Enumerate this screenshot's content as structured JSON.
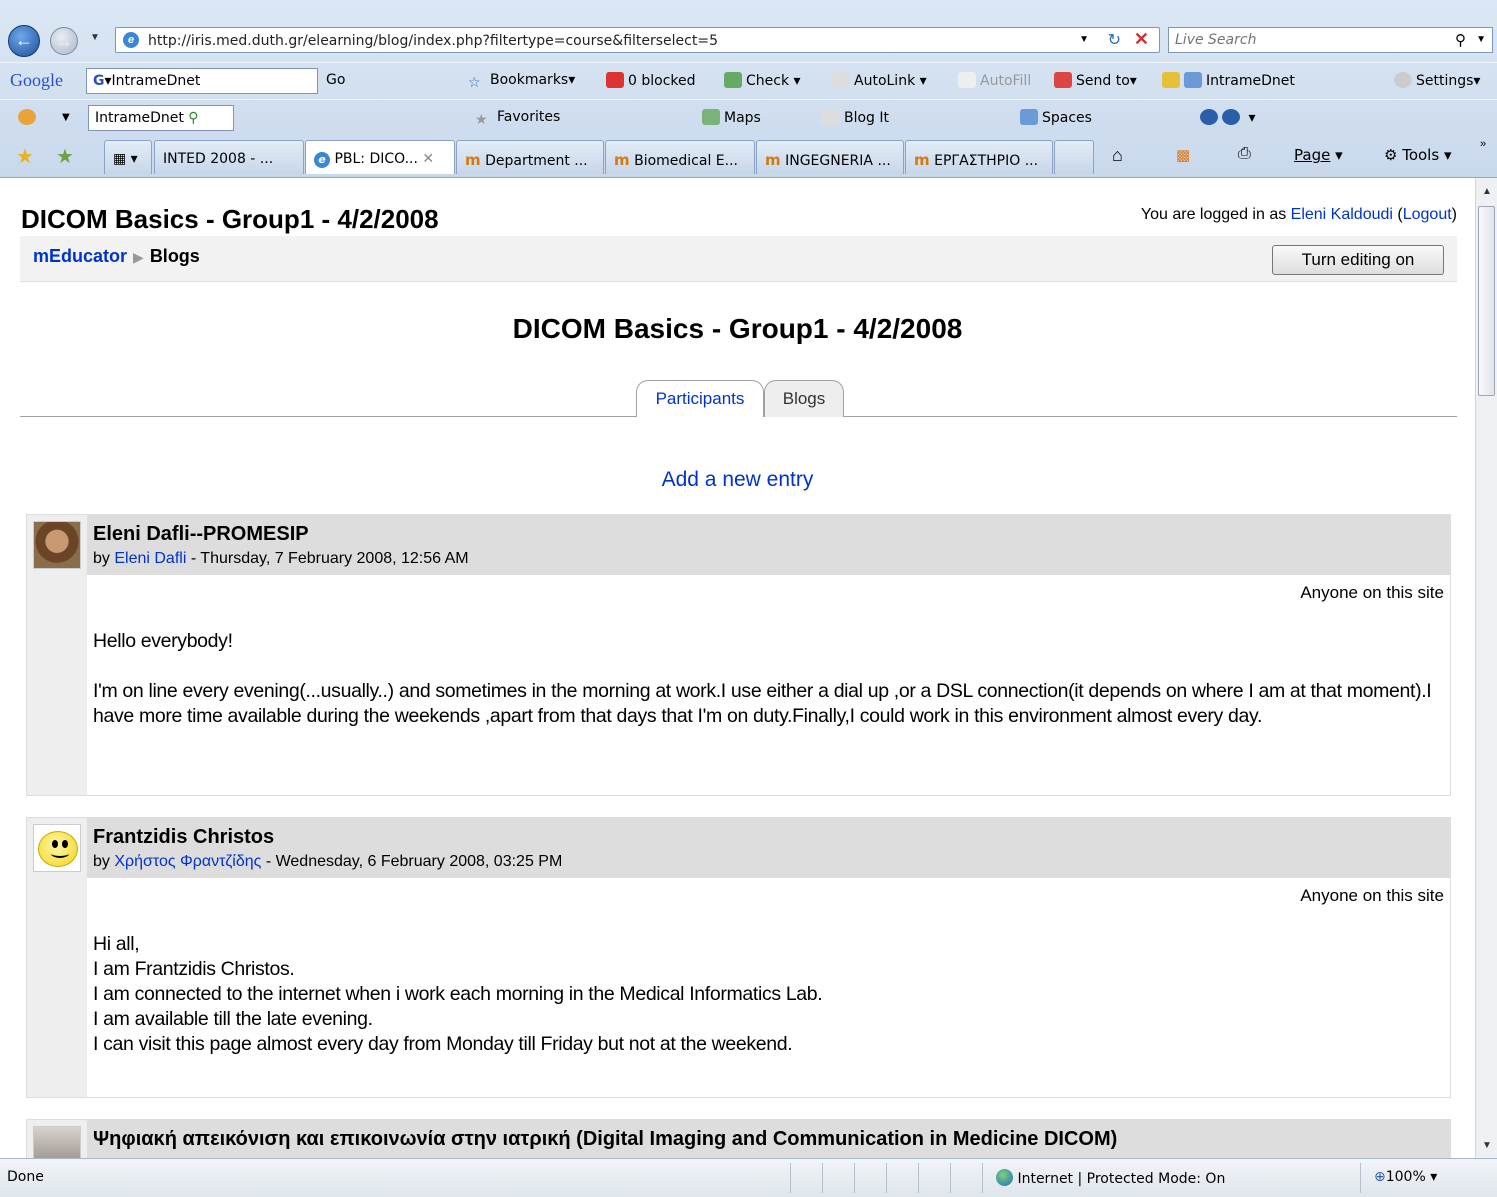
{
  "browser": {
    "url": "http://iris.med.duth.gr/elearning/blog/index.php?filtertype=course&filterselect=5",
    "search_placeholder": "Live Search",
    "google_toolbar": {
      "logo": "Google",
      "search_value": "IntrameDnet",
      "go": "Go",
      "bookmarks": "Bookmarks",
      "blocked": "0 blocked",
      "check": "Check",
      "autolink": "AutoLink",
      "autofill": "AutoFill",
      "send_to": "Send to",
      "intramednet": "IntrameDnet",
      "settings": "Settings"
    },
    "links_toolbar": {
      "search_value": "IntrameDnet",
      "favorites": "Favorites",
      "maps": "Maps",
      "blog_it": "Blog It",
      "spaces": "Spaces"
    },
    "tabs": [
      {
        "label": "INTED 2008 - ..."
      },
      {
        "label": "PBL: DICO..."
      },
      {
        "label": "Department ..."
      },
      {
        "label": "Biomedical E..."
      },
      {
        "label": "INGEGNERIA ..."
      },
      {
        "label": "ΕΡΓΑΣΤΗΡΙΟ ..."
      }
    ],
    "command_bar": {
      "page": "Page",
      "tools": "Tools"
    },
    "status": {
      "text": "Done",
      "zone": "Internet | Protected Mode: On",
      "zoom": "100%"
    }
  },
  "page": {
    "header_title": "DICOM Basics - Group1 - 4/2/2008",
    "login_prefix": "You are logged in as ",
    "login_user": "Eleni Kaldoudi",
    "logout": "Logout",
    "breadcrumb": {
      "home": "mEducator",
      "current": "Blogs"
    },
    "edit_button": "Turn editing on",
    "course_title": "DICOM Basics - Group1 - 4/2/2008",
    "tabs": {
      "participants": "Participants",
      "blogs": "Blogs"
    },
    "add_entry": "Add a new entry",
    "posts": [
      {
        "title": "Eleni Dafli--PROMESIP",
        "by": "by ",
        "author": "Eleni Dafli",
        "date": " - Thursday, 7 February 2008, 12:56 AM",
        "publish": "Anyone on this site",
        "paragraphs": [
          "Hello everybody!",
          "I'm on line every evening(...usually..) and sometimes in  the morning at work.I use either a dial up ,or a  DSL connection(it depends on where I am at that moment).I have more time available during the weekends ,apart from that days that I'm on duty.Finally,I could work in this environment almost every day."
        ]
      },
      {
        "title": "Frantzidis Christos",
        "by": "by ",
        "author": "Χρήστος Φραντζίδης",
        "date": " - Wednesday, 6 February 2008, 03:25 PM",
        "publish": "Anyone on this site",
        "lines": [
          "Hi all,",
          "I am Frantzidis Christos.",
          "I am connected to the internet when i work each morning in the Medical Informatics Lab.",
          "I am available till the late evening.",
          "I can visit this page almost every day from Monday till Friday but not at the weekend."
        ]
      },
      {
        "title": "Ψηφιακή απεικόνιση και επικοινωνία στην ιατρική (Digital Imaging and Communication in Medicine DICOM)"
      }
    ]
  }
}
